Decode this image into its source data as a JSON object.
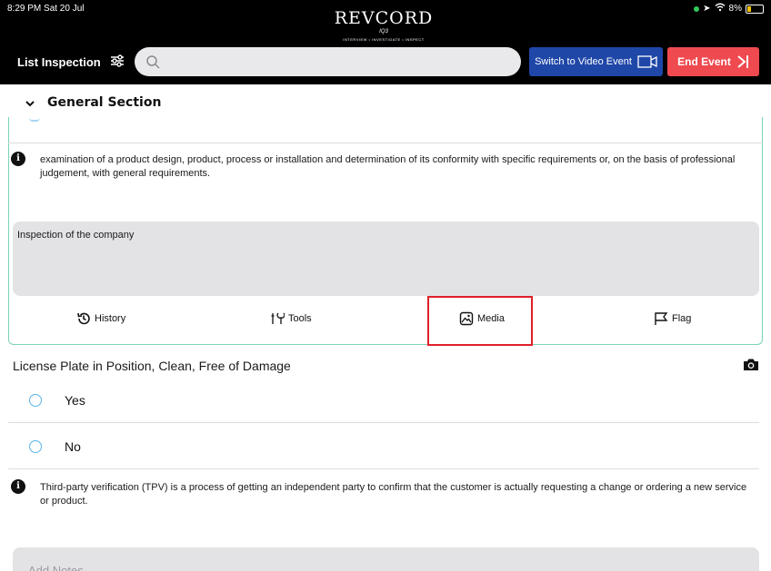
{
  "status_bar": {
    "time": "8:29 PM  Sat 20 Jul",
    "battery": "8%"
  },
  "logo": {
    "word": "REVCORD",
    "sub": "IQ3",
    "tagline": "INTERVIEW • INVESTIGATE • INSPECT"
  },
  "header": {
    "title": "List Inspection",
    "search_placeholder": "",
    "switch_video_label": "Switch to Video Event",
    "end_event_label": "End Event",
    "colors": {
      "video_button": "#1f47a8",
      "end_button": "#ee4a4f"
    }
  },
  "section": {
    "title": "General Section"
  },
  "card1": {
    "info_text": "examination of a product design, product, process or installation and determination of its conformity with specific requirements or, on the basis of professional judgement, with general requirements.",
    "notes_value": "Inspection of the company",
    "tools": [
      {
        "label": "History",
        "icon": "history-icon"
      },
      {
        "label": "Tools",
        "icon": "tools-icon"
      },
      {
        "label": "Media",
        "icon": "media-icon"
      },
      {
        "label": "Flag",
        "icon": "flag-icon"
      }
    ]
  },
  "card2": {
    "question": "License Plate in Position, Clean, Free of Damage",
    "options": [
      "Yes",
      "No"
    ],
    "info_text": "Third-party verification (TPV) is a process of getting an independent party to confirm that the customer is actually requesting a change or ordering a new service or product.",
    "notes_placeholder": "Add Notes"
  }
}
